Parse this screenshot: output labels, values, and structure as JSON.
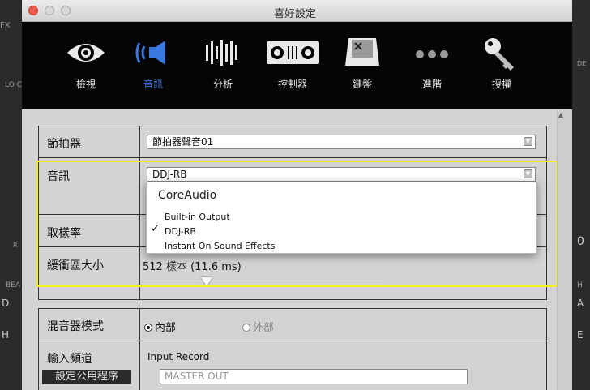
{
  "window": {
    "title": "喜好設定"
  },
  "background": {
    "left_labels": [
      "FX",
      "LO C",
      "R",
      "BEA",
      "D",
      "H"
    ],
    "right_labels": [
      "DE",
      "0",
      "H",
      "A",
      "E"
    ]
  },
  "toolbar": {
    "tabs": [
      {
        "label": "檢視",
        "icon": "eye-icon"
      },
      {
        "label": "音訊",
        "icon": "speaker-icon",
        "active": true
      },
      {
        "label": "分析",
        "icon": "waveform-icon"
      },
      {
        "label": "控制器",
        "icon": "controller-icon"
      },
      {
        "label": "鍵盤",
        "icon": "keyboard-key-icon"
      },
      {
        "label": "進階",
        "icon": "more-dots-icon"
      },
      {
        "label": "授權",
        "icon": "key-icon"
      }
    ]
  },
  "audio_panel": {
    "metronome_label": "節拍器",
    "metronome_value": "節拍器聲音01",
    "audio_label": "音訊",
    "audio_value": "DDJ-RB",
    "sample_rate_label": "取樣率",
    "buffer_label": "緩衝區大小",
    "buffer_value": "512 樣本 (11.6 ms)",
    "dropdown": {
      "header": "CoreAudio",
      "items": [
        "Built-in Output",
        "DDJ-RB",
        "Instant On Sound Effects"
      ],
      "checked": "DDJ-RB"
    }
  },
  "mixer_panel": {
    "mixer_mode_label": "混音器模式",
    "internal_label": "內部",
    "external_label": "外部",
    "input_channel_label": "輸入頻道",
    "input_record_label": "Input Record",
    "input_placeholder": "MASTER OUT",
    "utility_button": "設定公用程序"
  },
  "colors": {
    "highlight": "#f4f01c",
    "active_tab": "#3a78e0"
  }
}
